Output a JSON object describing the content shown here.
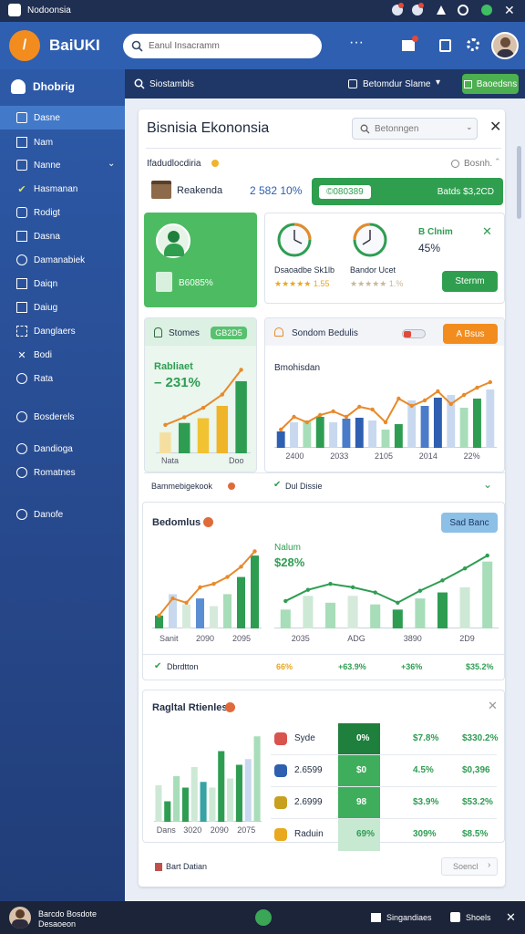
{
  "statusbar": {
    "title": "Nodoonsia"
  },
  "topbar": {
    "logo_text": "BaiUKI",
    "search_placeholder": "Eanul Insacramm",
    "menu_dots": "···"
  },
  "subbar": {
    "section": "Siostambls",
    "filter_label": "Betomdur Slame",
    "action_label": "Baoedsns"
  },
  "sidebar": {
    "header": "Dhobrig",
    "items": [
      "Dasne",
      "Nam",
      "Nanne",
      "Hasmanan",
      "Rodigt",
      "Dasna",
      "Damanabiek",
      "Daiqn",
      "Daiug",
      "Danglaers",
      "Bodi",
      "Rata",
      "Bosderels",
      "Dandioga",
      "Romatnes",
      "Danofe"
    ]
  },
  "page": {
    "title": "Bisnisia Ekononsia",
    "search_placeholder": "Betonngen"
  },
  "summary": {
    "label": "Ifadudlocdiria",
    "right_label": "Bosnh.",
    "company": "Reakenda",
    "value": "2 582 10%",
    "banner_left": "©080389",
    "banner_right": "Batds $3,2CD"
  },
  "kpi": {
    "value": "B6085%"
  },
  "rating": {
    "left_label": "Dsaoadbe Sk1lb",
    "left_score": "★★★★★ 1.55",
    "right_label": "Bandor Ucet",
    "right_score": "★★★★★ 1.%",
    "stat_title": "B Clnim",
    "stat_value": "45%",
    "button": "Sternm"
  },
  "chart_left": {
    "header": "Stomes",
    "badge": "GB2D5",
    "title": "Rabliaet",
    "value": "– 231%",
    "x_left": "Nata",
    "x_right": "Doo",
    "footer": "Bammebigekook",
    "chart_data": {
      "type": "bar",
      "categories": [
        "1",
        "2",
        "3",
        "4",
        "5"
      ],
      "values": [
        22,
        32,
        37,
        50,
        76
      ],
      "line": [
        30,
        38,
        48,
        62,
        88
      ],
      "ylim": [
        0,
        100
      ]
    }
  },
  "chart_mid": {
    "header": "Sondom Bedulis",
    "badge": "A Bsus",
    "subtitle": "Bmohisdan",
    "x_labels": [
      "2400",
      "2033",
      "2105",
      "2014",
      "22%"
    ],
    "footer": "Dul Dissie",
    "chart_data": {
      "type": "bar",
      "categories": [
        "1",
        "2",
        "3",
        "4",
        "5",
        "6",
        "7",
        "8",
        "9",
        "10",
        "11",
        "12",
        "13",
        "14",
        "15",
        "16",
        "17"
      ],
      "values": [
        18,
        28,
        30,
        34,
        28,
        32,
        33,
        30,
        20,
        26,
        52,
        46,
        55,
        58,
        44,
        54,
        64
      ],
      "line": [
        20,
        34,
        28,
        36,
        40,
        34,
        45,
        42,
        28,
        54,
        46,
        52,
        62,
        48,
        58,
        66,
        72
      ],
      "ylim": [
        0,
        80
      ]
    }
  },
  "section2": {
    "title": "Bedomlus",
    "button": "Sad Banc",
    "left_x": [
      "Sanit",
      "2090",
      "2095"
    ],
    "right_title": "Nalum",
    "right_value": "$28%",
    "right_x": [
      "2035",
      "ADG",
      "3890",
      "2D9"
    ],
    "stats": [
      "Dbrdtton",
      "66%",
      "+63.9%",
      "+36%",
      "$35.2%"
    ],
    "chart_left": {
      "type": "bar",
      "categories": [
        "1",
        "2",
        "3",
        "4",
        "5",
        "6",
        "7",
        "8"
      ],
      "values": [
        15,
        40,
        28,
        35,
        26,
        40,
        60,
        85
      ],
      "line": [
        15,
        35,
        30,
        48,
        52,
        60,
        72,
        90
      ],
      "ylim": [
        0,
        100
      ]
    },
    "chart_right": {
      "type": "bar",
      "categories": [
        "1",
        "2",
        "3",
        "4",
        "5",
        "6",
        "7",
        "8",
        "9",
        "10"
      ],
      "values": [
        22,
        38,
        30,
        38,
        28,
        22,
        35,
        42,
        48,
        78
      ],
      "line": [
        32,
        45,
        52,
        48,
        42,
        30,
        44,
        56,
        70,
        85
      ],
      "ylim": [
        0,
        100
      ]
    }
  },
  "section3": {
    "title": "Ragltal Rtienles",
    "x_labels": [
      "Dans",
      "3020",
      "2090",
      "2075"
    ],
    "chart_data": {
      "type": "bar",
      "categories": [
        "1",
        "2",
        "3",
        "4",
        "5",
        "6",
        "7",
        "8",
        "9",
        "10",
        "11",
        "12"
      ],
      "values": [
        32,
        18,
        40,
        30,
        48,
        35,
        30,
        62,
        38,
        50,
        55,
        75
      ],
      "ylim": [
        0,
        80
      ]
    },
    "rows": [
      {
        "name": "Syde",
        "col1": "0%",
        "col2": "$7.8%",
        "col3": "$330.2%"
      },
      {
        "name": "2.6599",
        "col1": "$0",
        "col2": "4.5%",
        "col3": "$0,396"
      },
      {
        "name": "2.6999",
        "col1": "98",
        "col2": "$3.9%",
        "col3": "$53.2%"
      },
      {
        "name": "Raduin",
        "col1": "69%",
        "col2": "309%",
        "col3": "$8.5%"
      }
    ],
    "footer": "Bart Datian",
    "footer_button": "Soencl"
  },
  "bottombar": {
    "user_line1": "Barcdo Bosdote",
    "user_line2": "Desaoeon",
    "left_btn": "Singandiaes",
    "right_btn": "Shoels"
  },
  "colors": {
    "green": "#2e9d52",
    "blue": "#2e5fb0",
    "orange": "#e88a2a",
    "light_green": "#a8ddb9",
    "light_blue": "#c8d9ef"
  }
}
